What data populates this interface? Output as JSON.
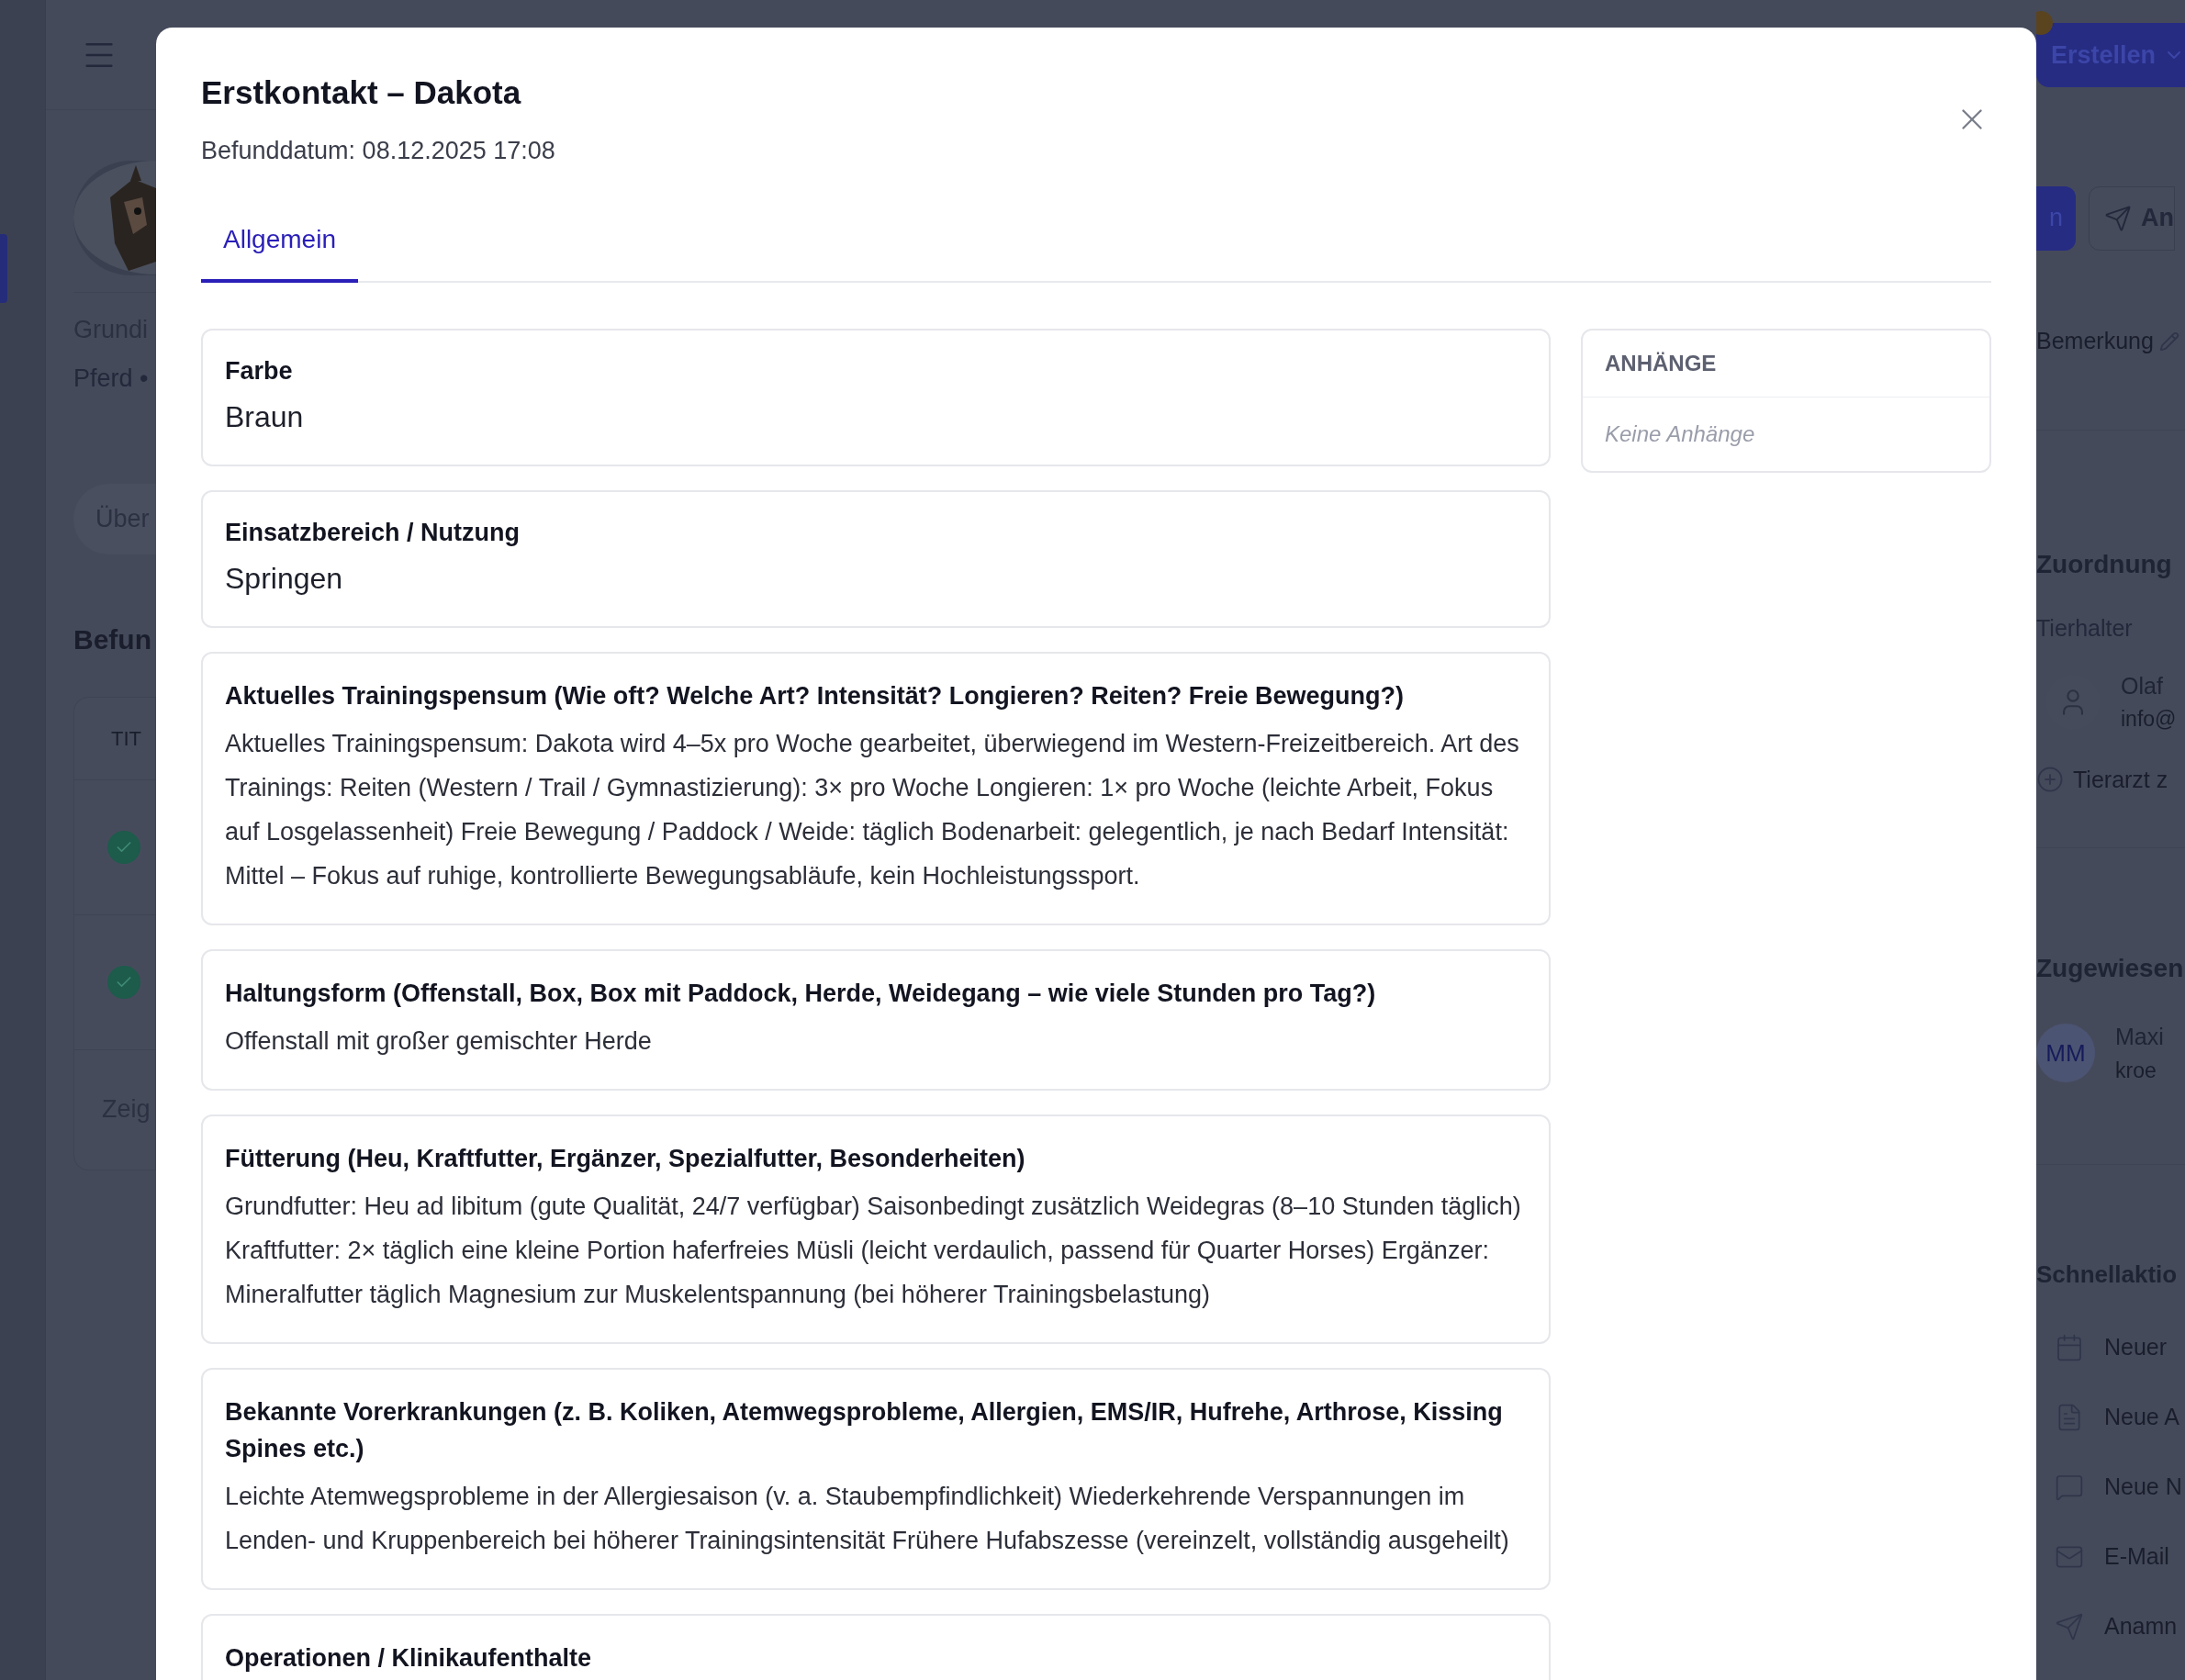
{
  "background": {
    "left": {
      "profile_label": "Grundi",
      "species": "Pferd •",
      "tab": "Über",
      "section_title": "Befun",
      "table_header": "TIT",
      "rows": [
        {
          "done": true
        },
        {
          "done": true
        }
      ],
      "show_more": "Zeig"
    },
    "right": {
      "create_button": "Erstellen",
      "primary_button": "n",
      "send_button": "An",
      "remark_label": "Bemerkung",
      "assignment_title": "Zuordnung",
      "owner_label": "Tierhalter",
      "owner_name": "Olaf",
      "owner_email": "info@",
      "add_vet": "Tierarzt z",
      "assigned_title": "Zugewiesen",
      "assignee_initials": "MM",
      "assignee_name": "Maxi",
      "assignee_email": "kroe",
      "quick_title": "Schnellaktio",
      "quick_actions": [
        {
          "kind": "calendar",
          "label": "Neuer"
        },
        {
          "kind": "file",
          "label": "Neue A"
        },
        {
          "kind": "chat",
          "label": "Neue N"
        },
        {
          "kind": "mail",
          "label": "E-Mail"
        },
        {
          "kind": "send",
          "label": "Anamn"
        }
      ]
    }
  },
  "modal": {
    "title": "Erstkontakt – Dakota",
    "subtitle": "Befunddatum: 08.12.2025 17:08",
    "tabs": [
      {
        "label": "Allgemein",
        "selected": true
      }
    ],
    "fields": [
      {
        "kind": "short",
        "label": "Farbe",
        "value": "Braun"
      },
      {
        "kind": "short",
        "label": "Einsatzbereich / Nutzung",
        "value": "Springen"
      },
      {
        "kind": "long",
        "label": "Aktuelles Trainingspensum (Wie oft? Welche Art? Intensität? Longieren? Reiten? Freie Bewegung?)",
        "value": "Aktuelles Trainingspensum: Dakota wird 4–5x pro Woche gearbeitet, überwiegend im Western-Freizeitbereich. Art des Trainings: Reiten (Western / Trail / Gymnastizierung): 3× pro Woche Longieren: 1× pro Woche (leichte Arbeit, Fokus auf Losgelassenheit) Freie Bewegung / Paddock / Weide: täglich Bodenarbeit: gelegentlich, je nach Bedarf Intensität: Mittel – Fokus auf ruhige, kontrollierte Bewegungsabläufe, kein Hochleistungssport."
      },
      {
        "kind": "long",
        "label": "Haltungsform (Offenstall, Box, Box mit Paddock, Herde, Weidegang – wie viele Stunden pro Tag?)",
        "value": "Offenstall mit großer gemischter Herde"
      },
      {
        "kind": "long",
        "label": "Fütterung (Heu, Kraftfutter, Ergänzer, Spezialfutter, Besonderheiten)",
        "value": "Grundfutter: Heu ad libitum (gute Qualität, 24/7 verfügbar) Saisonbedingt zusätzlich Weidegras (8–10 Stunden täglich) Kraftfutter: 2× täglich eine kleine Portion haferfreies Müsli (leicht verdaulich, passend für Quarter Horses) Ergänzer: Mineralfutter täglich Magnesium zur Muskelentspannung (bei höherer Trainingsbelastung)"
      },
      {
        "kind": "long",
        "label": "Bekannte Vorerkrankungen (z. B. Koliken, Atemwegsprobleme, Allergien, EMS/IR, Hufrehe, Arthrose, Kissing Spines etc.)",
        "value": "Leichte Atemwegsprobleme in der Allergiesaison (v. a. Staubempfindlichkeit) Wiederkehrende Verspannungen im Lenden- und Kruppenbereich bei höherer Trainingsintensität Frühere Hufabszesse (vereinzelt, vollständig ausgeheilt)"
      },
      {
        "kind": "long",
        "label": "Operationen / Klinikaufenthalte"
      }
    ],
    "attachments": {
      "title": "ANHÄNGE",
      "empty": "Keine Anhänge"
    }
  }
}
